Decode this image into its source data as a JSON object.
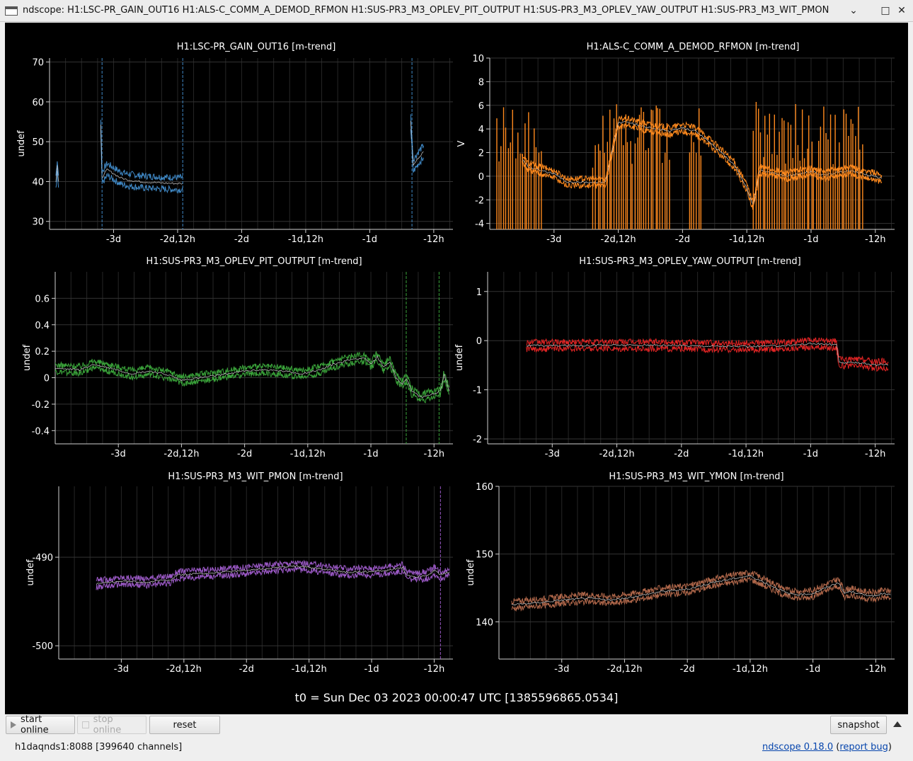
{
  "window": {
    "title": "ndscope: H1:LSC-PR_GAIN_OUT16 H1:ALS-C_COMM_A_DEMOD_RFMON H1:SUS-PR3_M3_OPLEV_PIT_OUTPUT H1:SUS-PR3_M3_OPLEV_YAW_OUTPUT H1:SUS-PR3_M3_WIT_PMON",
    "minimize": "⌄",
    "maximize": "□",
    "close": "✕"
  },
  "t0": "t0 = Sun Dec 03 2023 00:00:47 UTC [1385596865.0534]",
  "toolbar": {
    "start_online": "start online",
    "stop_online": "stop online",
    "reset": "reset",
    "snapshot": "snapshot"
  },
  "status": {
    "server": "h1daqnds1:8088  [399640 channels]",
    "version": "ndscope 0.18.0",
    "report_bug": "report bug"
  },
  "colors": {
    "blue": "#3f88c5",
    "orange": "#ff8a1e",
    "green": "#3aa33a",
    "red": "#e02424",
    "purple": "#9b59c6",
    "brown": "#b0674a"
  },
  "chart_data": [
    {
      "type": "line",
      "title": "H1:LSC-PR_GAIN_OUT16 [m-trend]",
      "ylabel": "undef",
      "xticks": [
        "-3d",
        "-2d,12h",
        "-2d",
        "-1d,12h",
        "-1d",
        "-12h"
      ],
      "yticks": [
        "30",
        "40",
        "50",
        "60",
        "70"
      ],
      "ylim": [
        28,
        71
      ],
      "color": "#3f88c5",
      "segments": [
        {
          "x": [
            -3.45,
            -3.44,
            -3.43
          ],
          "y": [
            40,
            44,
            40
          ]
        },
        {
          "x": [
            -3.1,
            -3.09,
            -3.05,
            -3.0,
            -2.95,
            -2.9,
            -2.8,
            -2.7,
            -2.6,
            -2.5,
            -2.46
          ],
          "y": [
            54,
            41,
            43,
            42,
            41,
            40.5,
            40,
            39.8,
            39.6,
            39.5,
            39.5
          ]
        },
        {
          "x": [
            -0.68,
            -0.66,
            -0.62,
            -0.58
          ],
          "y": [
            55,
            44,
            46,
            47.5
          ]
        }
      ],
      "spikes": [
        -3.09,
        -2.46,
        -0.67
      ]
    },
    {
      "type": "line",
      "title": "H1:ALS-C_COMM_A_DEMOD_RFMON [m-trend]",
      "ylabel": "V",
      "xticks": [
        "-3d",
        "-2d,12h",
        "-2d",
        "-1d,12h",
        "-1d",
        "-12h"
      ],
      "yticks": [
        "-4",
        "-2",
        "0",
        "2",
        "4",
        "6",
        "8",
        "10"
      ],
      "ylim": [
        -4.5,
        10
      ],
      "color": "#ff8a1e",
      "x": [
        -3.25,
        -3.2,
        -3.1,
        -3.0,
        -2.9,
        -2.6,
        -2.5,
        -2.45,
        -2.4,
        -2.3,
        -2.2,
        -2.1,
        -2.0,
        -1.9,
        -1.8,
        -1.7,
        -1.6,
        -1.5,
        -1.45,
        -1.4,
        -1.3,
        -1.2,
        -1.1,
        -1.0,
        -0.9,
        -0.8,
        -0.7,
        -0.6,
        -0.55,
        -0.5,
        -0.45
      ],
      "y": [
        1.5,
        0.8,
        0.5,
        0.2,
        -0.5,
        -0.5,
        4.5,
        4.6,
        4.5,
        4.2,
        4.0,
        3.8,
        4.1,
        3.8,
        3.0,
        2.0,
        1.0,
        -1.0,
        -2.5,
        0.5,
        0.3,
        0.0,
        0.2,
        0.4,
        0.1,
        0.3,
        0.5,
        0.2,
        0.1,
        0.0,
        -0.2
      ],
      "spike_ranges": [
        [
          -3.45,
          -3.1
        ],
        [
          -2.7,
          -2.1
        ],
        [
          -1.95,
          -1.85
        ],
        [
          -1.45,
          -0.6
        ]
      ]
    },
    {
      "type": "line",
      "title": "H1:SUS-PR3_M3_OPLEV_PIT_OUTPUT [m-trend]",
      "ylabel": "undef",
      "xticks": [
        "-3d",
        "-2d,12h",
        "-2d",
        "-1d,12h",
        "-1d",
        "-12h"
      ],
      "yticks": [
        "-0.4",
        "-0.2",
        "0",
        "0.2",
        "0.4",
        "0.6"
      ],
      "ylim": [
        -0.5,
        0.8
      ],
      "color": "#3aa33a",
      "x": [
        -3.5,
        -3.3,
        -3.2,
        -3.05,
        -2.9,
        -2.75,
        -2.6,
        -2.5,
        -2.35,
        -2.2,
        -2.0,
        -1.85,
        -1.7,
        -1.55,
        -1.4,
        -1.3,
        -1.15,
        -1.05,
        -1.0,
        -0.95,
        -0.9,
        -0.85,
        -0.8,
        -0.75,
        -0.72,
        -0.68,
        -0.6,
        -0.5,
        -0.45,
        -0.42,
        -0.38
      ],
      "y": [
        0.07,
        0.06,
        0.1,
        0.07,
        0.03,
        0.05,
        0.02,
        -0.02,
        0.0,
        0.02,
        0.05,
        0.06,
        0.05,
        0.03,
        0.06,
        0.1,
        0.14,
        0.15,
        0.1,
        0.16,
        0.08,
        0.12,
        0.0,
        -0.05,
        0.0,
        -0.1,
        -0.15,
        -0.12,
        -0.1,
        0.02,
        -0.1
      ],
      "spikes": [
        -0.72,
        -0.46
      ]
    },
    {
      "type": "line",
      "title": "H1:SUS-PR3_M3_OPLEV_YAW_OUTPUT [m-trend]",
      "ylabel": "undef",
      "xticks": [
        "-3d",
        "-2d,12h",
        "-2d",
        "-1d,12h",
        "-1d",
        "-12h"
      ],
      "yticks": [
        "-2",
        "-1",
        "0",
        "1"
      ],
      "ylim": [
        -2.1,
        1.4
      ],
      "color": "#e02424",
      "x": [
        -3.2,
        -3.0,
        -2.5,
        -2.0,
        -1.5,
        -1.2,
        -1.0,
        -0.8,
        -0.78,
        -0.6,
        -0.5,
        -0.45,
        -0.4
      ],
      "y": [
        -0.1,
        -0.1,
        -0.09,
        -0.1,
        -0.12,
        -0.1,
        -0.06,
        -0.08,
        -0.45,
        -0.45,
        -0.5,
        -0.48,
        -0.5
      ]
    },
    {
      "type": "line",
      "title": "H1:SUS-PR3_M3_WIT_PMON [m-trend]",
      "ylabel": "undef",
      "xticks": [
        "-3d",
        "-2d,12h",
        "-2d",
        "-1d,12h",
        "-1d",
        "-12h"
      ],
      "yticks": [
        "-500",
        "-490"
      ],
      "ylim": [
        -501.5,
        -482
      ],
      "color": "#9b59c6",
      "x": [
        -3.2,
        -3.0,
        -2.8,
        -2.6,
        -2.55,
        -2.3,
        -2.0,
        -1.8,
        -1.6,
        -1.4,
        -1.2,
        -1.0,
        -0.9,
        -0.75,
        -0.72,
        -0.65,
        -0.55,
        -0.5,
        -0.45,
        -0.38
      ],
      "y": [
        -493,
        -492.7,
        -492.8,
        -492.5,
        -492,
        -491.8,
        -491.5,
        -491.2,
        -491,
        -491.3,
        -491.7,
        -491.6,
        -491.5,
        -491.2,
        -492,
        -492.2,
        -492,
        -491.5,
        -492,
        -491.7
      ],
      "spikes": [
        -0.45
      ]
    },
    {
      "type": "line",
      "title": "H1:SUS-PR3_M3_WIT_YMON [m-trend]",
      "ylabel": "undef",
      "xticks": [
        "-3d",
        "-2d,12h",
        "-2d",
        "-1d,12h",
        "-1d",
        "-12h"
      ],
      "yticks": [
        "140",
        "150",
        "160"
      ],
      "ylim": [
        134.5,
        160
      ],
      "color": "#b0674a",
      "x": [
        -3.4,
        -3.2,
        -3.0,
        -2.8,
        -2.6,
        -2.4,
        -2.2,
        -2.0,
        -1.8,
        -1.6,
        -1.5,
        -1.35,
        -1.2,
        -1.1,
        -1.0,
        -0.9,
        -0.8,
        -0.75,
        -0.7,
        -0.6,
        -0.5,
        -0.45,
        -0.38
      ],
      "y": [
        142.5,
        142.8,
        143.2,
        143.5,
        143.2,
        143.8,
        144.5,
        144.8,
        145.8,
        146.5,
        146.8,
        145.5,
        144.2,
        144.0,
        144.2,
        145.0,
        145.8,
        144.2,
        144.5,
        144.0,
        143.8,
        144.2,
        144.0
      ]
    }
  ]
}
